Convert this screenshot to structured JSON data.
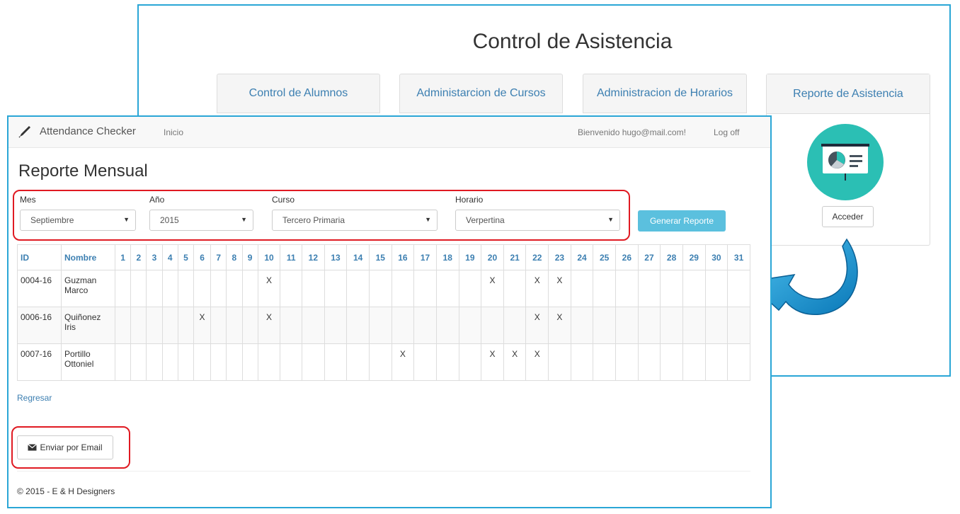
{
  "back_window": {
    "title": "Control de Asistencia",
    "cards": [
      "Control de Alumnos",
      "Administarcion de Cursos",
      "Administracion de Horarios"
    ],
    "report_card": {
      "title": "Reporte de Asistencia",
      "button": "Acceder"
    }
  },
  "navbar": {
    "brand": "Attendance Checker",
    "inicio": "Inicio",
    "welcome": "Bienvenido hugo@mail.com!",
    "logoff": "Log off"
  },
  "page": {
    "title": "Reporte Mensual"
  },
  "filters": {
    "mes": {
      "label": "Mes",
      "value": "Septiembre"
    },
    "anio": {
      "label": "Año",
      "value": "2015"
    },
    "curso": {
      "label": "Curso",
      "value": "Tercero Primaria"
    },
    "horario": {
      "label": "Horario",
      "value": "Verpertina"
    },
    "generate_button": "Generar Reporte"
  },
  "table": {
    "headers": [
      "ID",
      "Nombre",
      "1",
      "2",
      "3",
      "4",
      "5",
      "6",
      "7",
      "8",
      "9",
      "10",
      "11",
      "12",
      "13",
      "14",
      "15",
      "16",
      "17",
      "18",
      "19",
      "20",
      "21",
      "22",
      "23",
      "24",
      "25",
      "26",
      "27",
      "28",
      "29",
      "30",
      "31"
    ],
    "rows": [
      {
        "id": "0004-16",
        "name": "Guzman Marco",
        "absences": [
          10,
          20,
          22,
          23
        ]
      },
      {
        "id": "0006-16",
        "name": "Quiñonez Iris",
        "absences": [
          6,
          10,
          22,
          23
        ]
      },
      {
        "id": "0007-16",
        "name": "Portillo Ottoniel",
        "absences": [
          16,
          20,
          21,
          22
        ]
      }
    ],
    "mark": "X"
  },
  "links": {
    "back": "Regresar"
  },
  "email_button": "Enviar por Email",
  "footer": "© 2015 - E & H Designers",
  "colors": {
    "accent": "#2aa6d6",
    "highlight": "#e01a22",
    "link": "#3c7fb1",
    "info_button": "#5bc0de",
    "icon_circle": "#2bbfb4"
  }
}
